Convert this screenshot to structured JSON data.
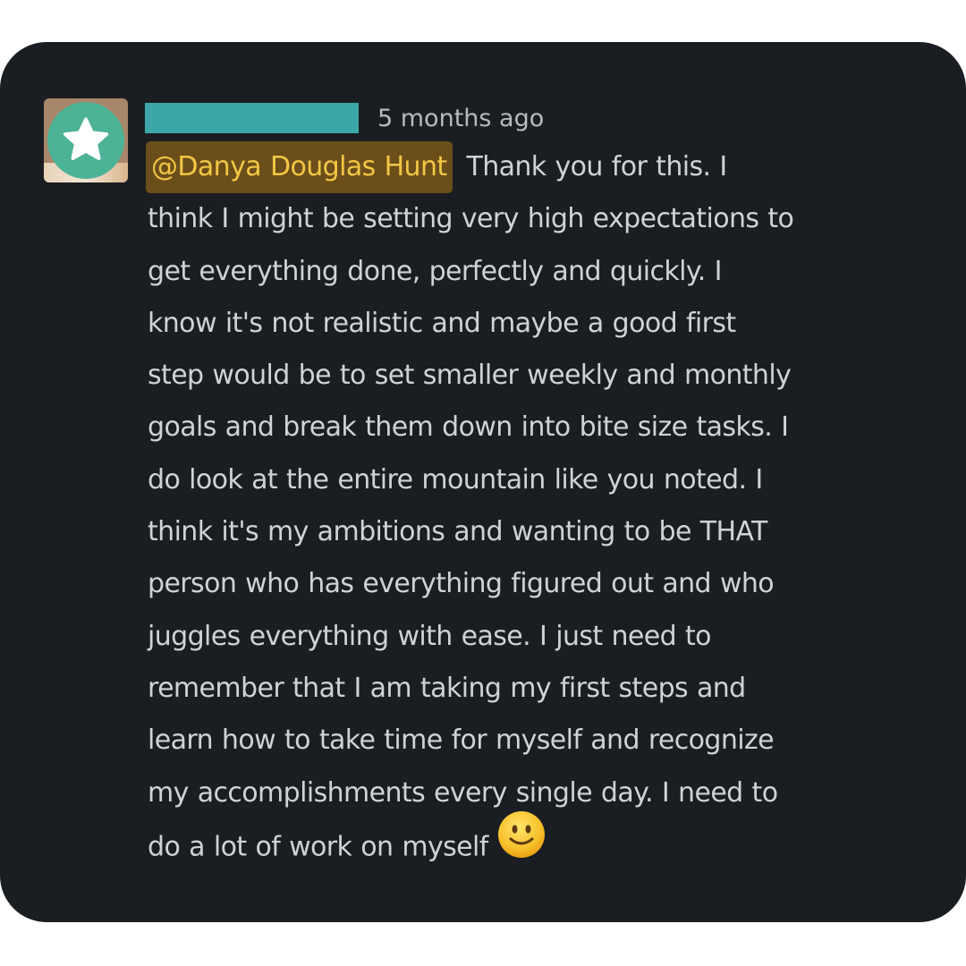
{
  "message": {
    "timestamp": "5 months ago",
    "mention": "@Danya Douglas Hunt",
    "lines": [
      " Thank you for this. I",
      "think I might be setting very high expectations to",
      "get everything done, perfectly and quickly. I",
      "know it's not realistic and maybe a good first",
      "step would be to set smaller weekly and monthly",
      "goals and break them down into bite size tasks. I",
      "do look at the entire mountain like you noted. I",
      "think it's my ambitions and wanting to be THAT",
      "person who has everything figured out and who",
      "juggles everything with ease. I just need to",
      "remember that I am taking my first steps and",
      "learn how to take time for myself and recognize",
      "my accomplishments every single day. I need to",
      "do a lot of work on myself"
    ],
    "emoji": "slightly-smiling-face",
    "avatar_icon": "star-icon"
  },
  "colors": {
    "background": "#1a1d21",
    "text": "#d1d2d3",
    "timestamp": "#b9babd",
    "mention_bg": "#6b4e1a",
    "mention_text": "#f2c744",
    "name_redaction": "#3ba7a9",
    "avatar_badge": "#4db396"
  }
}
